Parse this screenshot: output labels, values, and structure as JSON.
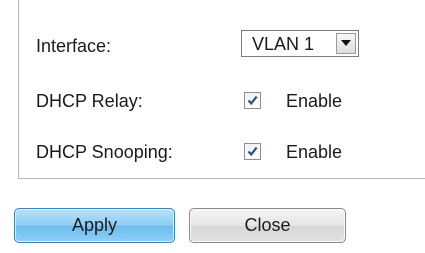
{
  "form": {
    "interface_label": "Interface:",
    "interface_value": "VLAN 1",
    "dhcp_relay_label": "DHCP Relay:",
    "dhcp_relay_checked": true,
    "dhcp_relay_option": "Enable",
    "dhcp_snooping_label": "DHCP Snooping:",
    "dhcp_snooping_checked": true,
    "dhcp_snooping_option": "Enable"
  },
  "buttons": {
    "apply_label": "Apply",
    "close_label": "Close"
  },
  "colors": {
    "apply_button": "#8cccf4",
    "close_button": "#e2e2e2",
    "panel_border": "#b5b5b5"
  },
  "icons": {
    "dropdown": "chevron-down-icon",
    "check": "check-icon"
  }
}
